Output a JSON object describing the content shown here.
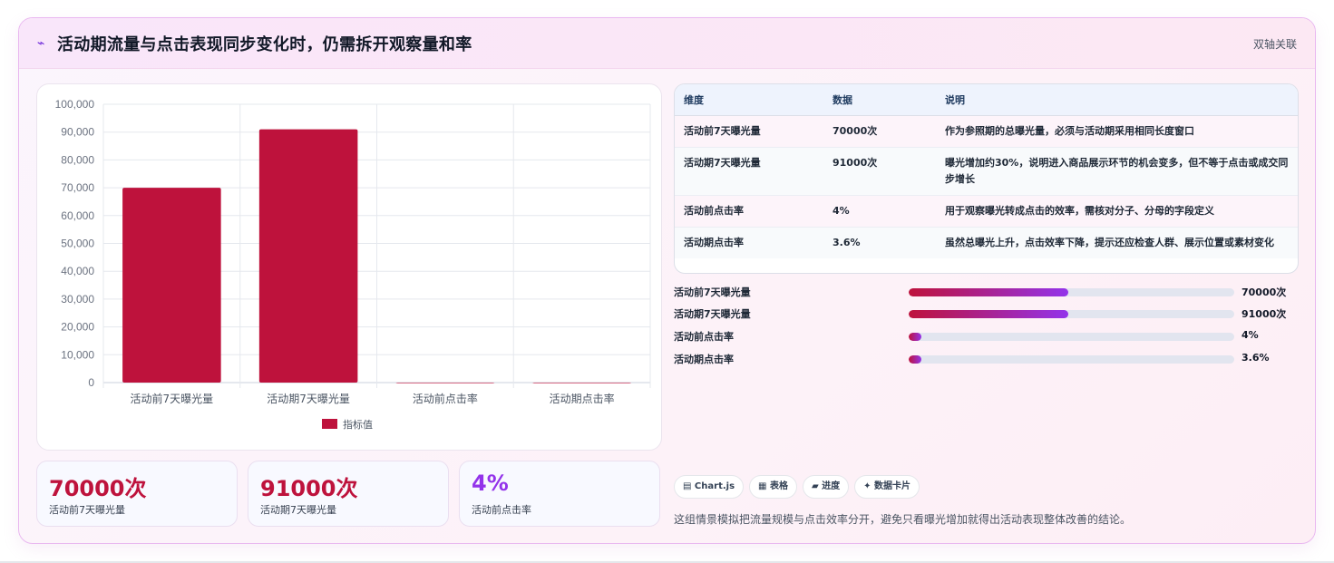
{
  "header": {
    "icon": "sparkline-icon",
    "title": "活动期流量与点击表现同步变化时，仍需拆开观察量和率",
    "action": "双轴关联"
  },
  "chart_data": {
    "type": "bar",
    "categories": [
      "活动前7天曝光量",
      "活动期7天曝光量",
      "活动前点击率",
      "活动期点击率"
    ],
    "series": [
      {
        "name": "指标值",
        "values": [
          70000,
          91000,
          4,
          3.6
        ]
      }
    ],
    "ylim": [
      0,
      100000
    ],
    "yticks": [
      "100,000",
      "90,000",
      "80,000",
      "70,000",
      "60,000",
      "50,000",
      "40,000",
      "30,000",
      "20,000",
      "10,000",
      "0"
    ],
    "ytick_values": [
      100000,
      90000,
      80000,
      70000,
      60000,
      50000,
      40000,
      30000,
      20000,
      10000,
      0
    ],
    "legend_position": "bottom",
    "grid": true,
    "bar_color": "#be123c"
  },
  "kpis": [
    {
      "value": "70000次",
      "label": "活动前7天曝光量",
      "color": "#be123c"
    },
    {
      "value": "91000次",
      "label": "活动期7天曝光量",
      "color": "#be123c"
    },
    {
      "value": "4%",
      "label": "活动前点击率",
      "color": "#9333ea"
    }
  ],
  "table": {
    "headers": [
      "维度",
      "数据",
      "说明"
    ],
    "rows": [
      [
        "活动前7天曝光量",
        "70000次",
        "作为参照期的总曝光量，必须与活动期采用相同长度窗口"
      ],
      [
        "活动期7天曝光量",
        "91000次",
        "曝光增加约30%，说明进入商品展示环节的机会变多，但不等于点击或成交同步增长"
      ],
      [
        "活动前点击率",
        "4%",
        "用于观察曝光转成点击的效率，需核对分子、分母的字段定义"
      ],
      [
        "活动期点击率",
        "3.6%",
        "虽然总曝光上升，点击效率下降，提示还应检查人群、展示位置或素材变化"
      ]
    ]
  },
  "progress": [
    {
      "label": "活动前7天曝光量",
      "value": "70000次",
      "fraction": 0.49
    },
    {
      "label": "活动期7天曝光量",
      "value": "91000次",
      "fraction": 0.49
    },
    {
      "label": "活动前点击率",
      "value": "4%",
      "fraction": 0.04
    },
    {
      "label": "活动期点击率",
      "value": "3.6%",
      "fraction": 0.04
    }
  ],
  "chips": [
    "▤ Chart.js",
    "▦ 表格",
    "▰ 进度",
    "✦ 数据卡片"
  ],
  "footnote": "这组情景模拟把流量规模与点击效率分开，避免只看曝光增加就得出活动表现整体改善的结论。"
}
